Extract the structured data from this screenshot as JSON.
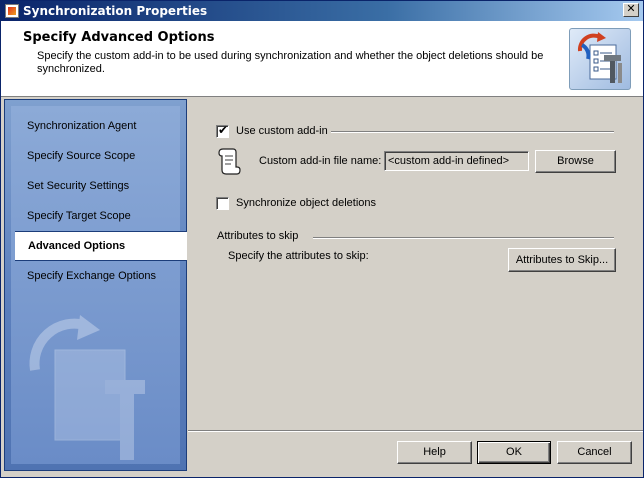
{
  "window": {
    "title": "Synchronization Properties"
  },
  "header": {
    "heading": "Specify Advanced Options",
    "description": "Specify the custom add-in to be used during synchronization and whether the object deletions should be synchronized."
  },
  "nav": {
    "items": [
      {
        "label": "Synchronization Agent",
        "active": false
      },
      {
        "label": "Specify Source Scope",
        "active": false
      },
      {
        "label": "Set Security Settings",
        "active": false
      },
      {
        "label": "Specify Target Scope",
        "active": false
      },
      {
        "label": "Advanced Options",
        "active": true
      },
      {
        "label": "Specify Exchange Options",
        "active": false
      }
    ]
  },
  "content": {
    "use_custom_addin": {
      "label": "Use custom add-in",
      "checked": true
    },
    "addin_file_label": "Custom add-in file name:",
    "addin_file_value": "<custom add-in defined>",
    "browse_label": "Browse",
    "sync_deletions": {
      "label": "Synchronize object deletions",
      "checked": false
    },
    "attributes_group": "Attributes to skip",
    "attributes_label": "Specify the attributes to skip:",
    "attributes_button": "Attributes to Skip..."
  },
  "footer": {
    "help_label": "Help",
    "ok_label": "OK",
    "cancel_label": "Cancel"
  },
  "icons": {
    "close": "close-icon",
    "app": "app-icon",
    "header": "sync-tools-icon",
    "addin": "scroll-icon",
    "check": "✔"
  },
  "colors": {
    "title_bar": "#0a246a",
    "nav_panel": "#6a8cc7",
    "dialog_face": "#d4d0c8"
  }
}
